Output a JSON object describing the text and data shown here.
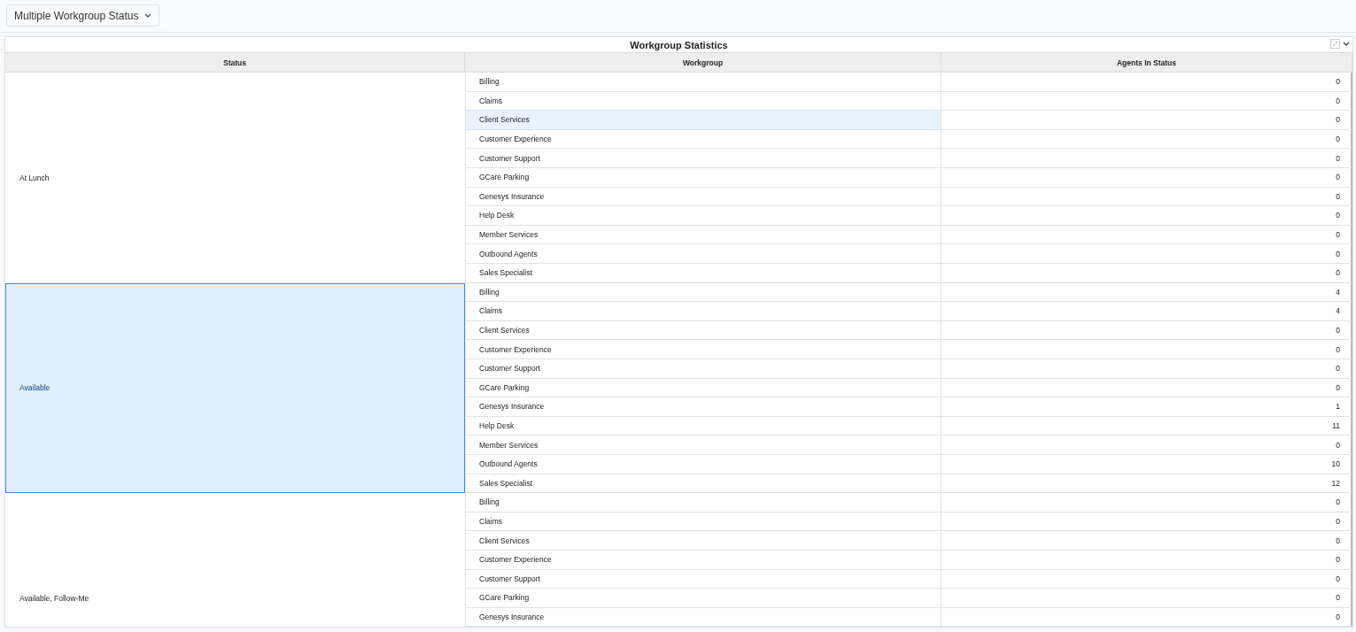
{
  "view_selector": {
    "label": "Multiple Workgroup Status"
  },
  "panel": {
    "title": "Workgroup Statistics"
  },
  "table": {
    "columns": [
      "Status",
      "Workgroup",
      "Agents In Status"
    ],
    "groups": [
      {
        "status": "At Lunch",
        "selected": false,
        "rows": [
          {
            "workgroup": "Billing",
            "agents": "0",
            "selected": false
          },
          {
            "workgroup": "Claims",
            "agents": "0",
            "selected": false
          },
          {
            "workgroup": "Client Services",
            "agents": "0",
            "selected": true
          },
          {
            "workgroup": "Customer Experience",
            "agents": "0",
            "selected": false
          },
          {
            "workgroup": "Customer Support",
            "agents": "0",
            "selected": false
          },
          {
            "workgroup": "GCare Parking",
            "agents": "0",
            "selected": false
          },
          {
            "workgroup": "Genesys Insurance",
            "agents": "0",
            "selected": false
          },
          {
            "workgroup": "Help Desk",
            "agents": "0",
            "selected": false
          },
          {
            "workgroup": "Member Services",
            "agents": "0",
            "selected": false
          },
          {
            "workgroup": "Outbound Agents",
            "agents": "0",
            "selected": false
          },
          {
            "workgroup": "Sales Specialist",
            "agents": "0",
            "selected": false
          }
        ]
      },
      {
        "status": "Available",
        "selected": true,
        "rows": [
          {
            "workgroup": "Billing",
            "agents": "4",
            "selected": false
          },
          {
            "workgroup": "Claims",
            "agents": "4",
            "selected": false
          },
          {
            "workgroup": "Client Services",
            "agents": "0",
            "selected": false
          },
          {
            "workgroup": "Customer Experience",
            "agents": "0",
            "selected": false
          },
          {
            "workgroup": "Customer Support",
            "agents": "0",
            "selected": false
          },
          {
            "workgroup": "GCare Parking",
            "agents": "0",
            "selected": false
          },
          {
            "workgroup": "Genesys Insurance",
            "agents": "1",
            "selected": false
          },
          {
            "workgroup": "Help Desk",
            "agents": "11",
            "selected": false
          },
          {
            "workgroup": "Member Services",
            "agents": "0",
            "selected": false
          },
          {
            "workgroup": "Outbound Agents",
            "agents": "10",
            "selected": false
          },
          {
            "workgroup": "Sales Specialist",
            "agents": "12",
            "selected": false
          }
        ]
      },
      {
        "status": "Available, Follow-Me",
        "selected": false,
        "rows": [
          {
            "workgroup": "Billing",
            "agents": "0",
            "selected": false
          },
          {
            "workgroup": "Claims",
            "agents": "0",
            "selected": false
          },
          {
            "workgroup": "Client Services",
            "agents": "0",
            "selected": false
          },
          {
            "workgroup": "Customer Experience",
            "agents": "0",
            "selected": false
          },
          {
            "workgroup": "Customer Support",
            "agents": "0",
            "selected": false
          },
          {
            "workgroup": "GCare Parking",
            "agents": "0",
            "selected": false
          },
          {
            "workgroup": "Genesys Insurance",
            "agents": "0",
            "selected": false
          }
        ]
      }
    ]
  }
}
